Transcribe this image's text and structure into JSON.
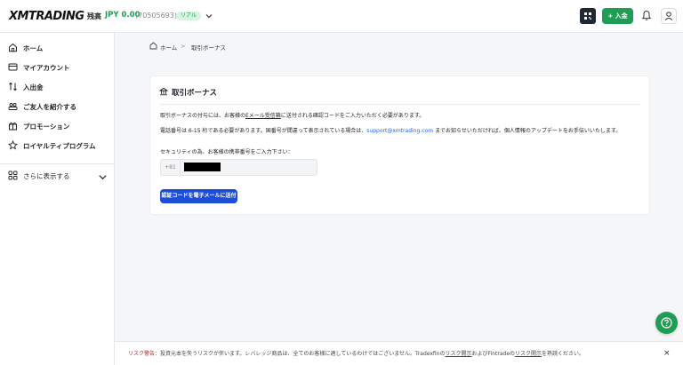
{
  "header": {
    "logo": "XMTRADING",
    "balance_label": "残高",
    "balance_amount": "JPY 0.00",
    "account_id": "(70505693)",
    "account_type": "リアル",
    "deposit_label": "+ 入金"
  },
  "sidebar": {
    "items": [
      {
        "label": "ホーム",
        "icon": "home-icon"
      },
      {
        "label": "マイアカウント",
        "icon": "card-icon"
      },
      {
        "label": "入出金",
        "icon": "transfer-icon"
      },
      {
        "label": "ご友人を紹介する",
        "icon": "people-icon"
      },
      {
        "label": "プロモーション",
        "icon": "gift-icon"
      },
      {
        "label": "ロイヤルティプログラム",
        "icon": "star-icon"
      }
    ],
    "more_label": "さらに表示する"
  },
  "breadcrumb": {
    "home": "ホーム",
    "separator": ">",
    "current": "取引ボーナス"
  },
  "card": {
    "title": "取引ボーナス",
    "para1_a": "取引ボーナスの付与には、お客様の",
    "para1_link": "Eメール受信箱",
    "para1_b": "に送付される確認コードをご入力いただく必要があります。",
    "para2_a": "電話番号は 6-15 桁である必要があります。国番号が間違って表示されている場合は、",
    "para2_email": "support@xmtrading.com",
    "para2_b": " までお知らせいただければ、個人情報のアップデートをお手伝いいたします。",
    "phone_label": "セキュリティの為、お客様の携帯番号をご入力下さい：",
    "phone_prefix": "+81",
    "send_button": "認証コードを電子メールに送付"
  },
  "risk_bar": {
    "warning_label": "リスク警告：",
    "text_a": "投資元本を失うリスクが伴います。レバレッジ商品は、全てのお客様に適しているわけではございません。Tradexfinの",
    "link1": "リスク開示",
    "text_b": "およびFintradeの",
    "link2": "リスク開示",
    "text_c": "を熟読ください。",
    "close": "×"
  },
  "colors": {
    "accent_green": "#1e9e54",
    "primary_blue": "#1d4ed8",
    "link_blue": "#2563eb",
    "warning_red": "#b91c1c"
  }
}
